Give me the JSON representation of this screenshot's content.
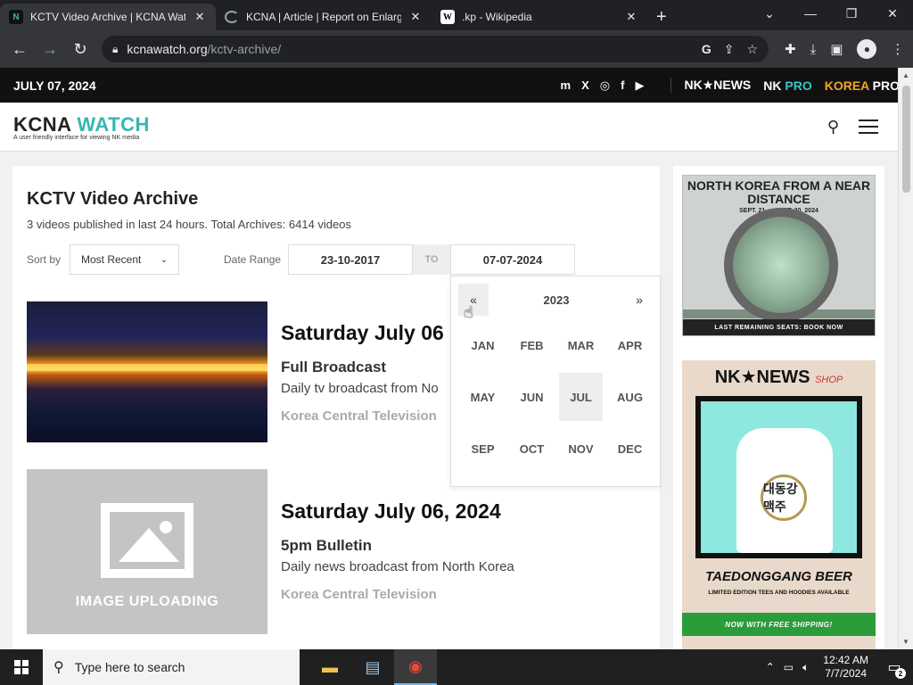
{
  "browser": {
    "tabs": [
      {
        "title": "KCTV Video Archive | KCNA Watc",
        "active": true,
        "favicon": "kcna-favicon"
      },
      {
        "title": "KCNA | Article | Report on Enlarg",
        "active": false,
        "favicon": "loading-spinner"
      },
      {
        "title": ".kp - Wikipedia",
        "active": false,
        "favicon": "wikipedia-favicon"
      }
    ],
    "new_tab": "+",
    "url_host": "kcnawatch.org",
    "url_path": "/kctv-archive/"
  },
  "site": {
    "date": "JULY 07, 2024",
    "social": [
      "m",
      "X",
      "◎",
      "f",
      "▶"
    ],
    "brands": {
      "nknews": "NK★NEWS",
      "nkpro_a": "NK",
      "nkpro_b": "PRO",
      "korea_pro_a": "KOREA",
      "korea_pro_b": "PRO"
    },
    "logo_a": "KCNA",
    "logo_b": "WATCH",
    "logo_tagline": "A user friendly interface for viewing NK media"
  },
  "archive": {
    "title": "KCTV Video Archive",
    "subtitle": "3 videos published in last 24 hours. Total Archives: 6414 videos",
    "sort_label": "Sort by",
    "sort_value": "Most Recent",
    "date_range_label": "Date Range",
    "date_from": "23-10-2017",
    "to_label": "TO",
    "date_to": "07-07-2024"
  },
  "picker": {
    "prev": "«",
    "year": "2023",
    "next": "»",
    "months": [
      "JAN",
      "FEB",
      "MAR",
      "APR",
      "MAY",
      "JUN",
      "JUL",
      "AUG",
      "SEP",
      "OCT",
      "NOV",
      "DEC"
    ],
    "selected": "JUL"
  },
  "items": [
    {
      "date": "Saturday July 06",
      "type": "Full Broadcast",
      "desc": "Daily tv broadcast from No",
      "source": "Korea Central Television"
    },
    {
      "date": "Saturday July 06, 2024",
      "type": "5pm Bulletin",
      "desc": "Daily news broadcast from North Korea",
      "source": "Korea Central Television",
      "placeholder_text": "IMAGE UPLOADING"
    }
  ],
  "ads": {
    "ad1_title": "NORTH KOREA FROM A NEAR DISTANCE",
    "ad1_dates": "SEPT. 21 — SEPT. 30, 2024",
    "ad1_footer": "LAST REMAINING SEATS: BOOK NOW",
    "ad2_head": "NK★NEWS",
    "ad2_shop": "SHOP",
    "ad2_badge": "대동강맥주",
    "ad2_product": "TAEDONGGANG BEER",
    "ad2_limited": "LIMITED EDITION TEES AND HOODIES AVAILABLE",
    "ad2_ship": "NOW WITH FREE SHIPPING!"
  },
  "taskbar": {
    "search_placeholder": "Type here to search",
    "time": "12:42 AM",
    "date": "7/7/2024",
    "notifications": "2"
  }
}
